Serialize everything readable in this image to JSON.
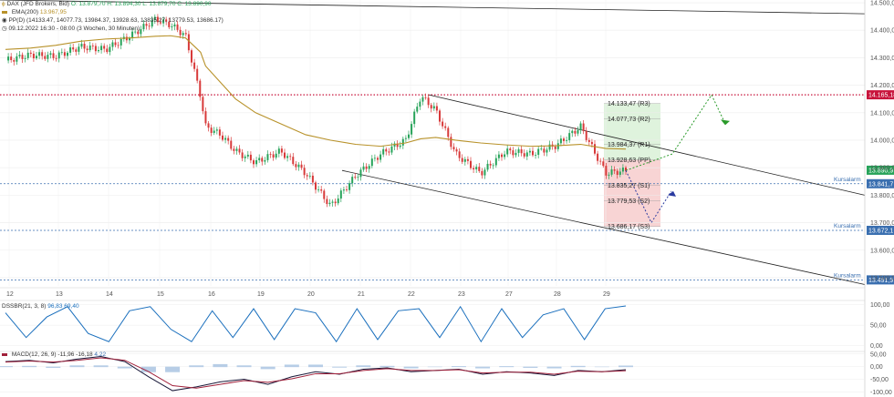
{
  "legend": {
    "instrument": "DAX (JFD Brokers, Bid)",
    "ohlc": "O: 13.879,70  H: 13.894,30  L: 13.879,70  C: 13.890,90",
    "ema_label": "EMA(200)",
    "ema_value": "13.967,95",
    "pp_label": "PP(D)",
    "pp_values": "(14133.47, 14077.73, 13984.37, 13928.63, 13835.27, 13779.53, 13686.17)",
    "timestamp": "09.12.2022 16:30 - 08:00",
    "range": "(3 Wochen, 30 Minuten)",
    "dss_label": "DSSBR(21, 3, 8)",
    "dss_values": "96,83  69,40",
    "macd_label": "MACD(12, 26, 9)",
    "macd_values": "-11,96  -16,18",
    "macd_extra": "4,22"
  },
  "colors": {
    "up": "#27a35a",
    "down": "#d83a3a",
    "ema": "#b8922a",
    "resistance": "#c8143c",
    "alarm": "#3a6fb0",
    "channel": "#222222",
    "arrow_green": "#2a9a2a",
    "arrow_blue": "#2a3aa0",
    "zone_green": "#dff3dd",
    "zone_red": "#f8d4d4",
    "dss": "#1a6fbd",
    "macd": "#1a1a3a",
    "signal": "#a0203a"
  },
  "chart_data": {
    "type": "line",
    "title": "DAX (JFD Brokers, Bid)",
    "xlabel": "",
    "ylabel": "",
    "x_ticks": [
      "12",
      "13",
      "14",
      "15",
      "16",
      "19",
      "20",
      "21",
      "22",
      "23",
      "27",
      "28",
      "29"
    ],
    "y_ticks": [
      "14.500,00",
      "14.400,00",
      "14.300,00",
      "14.200,00",
      "14.100,00",
      "14.000,00",
      "13.900,00",
      "13.800,00",
      "13.700,00",
      "13.600,00",
      "13.500,00"
    ],
    "ylim": [
      13470,
      14510
    ],
    "x": [
      0,
      0.5,
      1,
      1.5,
      2,
      2.5,
      3,
      3.3,
      3.6,
      3.9,
      4,
      4.3,
      4.6,
      5,
      5.5,
      6,
      6.5,
      7,
      7.5,
      8,
      8.3,
      8.6,
      9,
      9.5,
      10,
      10.5,
      11,
      11.5,
      12,
      12.4
    ],
    "series": [
      {
        "name": "DAX",
        "values": [
          14290,
          14310,
          14305,
          14340,
          14330,
          14380,
          14440,
          14420,
          14380,
          14160,
          14050,
          14020,
          13960,
          13920,
          13960,
          13880,
          13760,
          13870,
          13950,
          14000,
          14160,
          14110,
          13950,
          13880,
          13960,
          13950,
          13980,
          14050,
          13880,
          13890
        ]
      },
      {
        "name": "EMA(200)",
        "values": [
          14330,
          14335,
          14345,
          14360,
          14368,
          14372,
          14378,
          14380,
          14372,
          14320,
          14270,
          14210,
          14150,
          14100,
          14060,
          14020,
          14000,
          13985,
          13978,
          13990,
          14005,
          14010,
          14000,
          13990,
          13983,
          13978,
          13980,
          13985,
          13970,
          13968
        ]
      }
    ],
    "levels": [
      {
        "label": "14.133,47 (R3)",
        "value": 14133.47
      },
      {
        "label": "14.077,73 (R2)",
        "value": 14077.73
      },
      {
        "label": "13.984,37 (R1)",
        "value": 13984.37
      },
      {
        "label": "13.928,63 (PP)",
        "value": 13928.63
      },
      {
        "label": "13.835,27 (S1)",
        "value": 13835.27
      },
      {
        "label": "13.779,53 (S2)",
        "value": 13779.53
      },
      {
        "label": "13.686,17 (S3)",
        "value": 13686.17
      }
    ],
    "resistance": {
      "value": 14165.18,
      "badge": "14.165,18"
    },
    "alarms": [
      {
        "label": "Kursalarm",
        "value": 13841.7,
        "badge": "13.841,7"
      },
      {
        "label": "Kursalarm",
        "value": 13672.1,
        "badge": "13.672,1"
      },
      {
        "label": "Kursalarm",
        "value": 13491.9,
        "badge": "13.491,9"
      }
    ],
    "last_price": {
      "value": 13890.9,
      "badge": "13.890,9"
    },
    "dss": {
      "ticks": [
        "100,00",
        "50,00",
        "0,00"
      ],
      "ylim": [
        -5,
        110
      ],
      "values": [
        80,
        20,
        70,
        95,
        30,
        10,
        85,
        95,
        40,
        10,
        85,
        20,
        90,
        15,
        90,
        80,
        10,
        90,
        15,
        85,
        90,
        20,
        95,
        10,
        90,
        20,
        75,
        90,
        15,
        90,
        96.83
      ]
    },
    "macd": {
      "ticks": [
        "50,00",
        "0,00",
        "-50,00",
        "-100,00"
      ],
      "ylim": [
        -120,
        60
      ],
      "macd": [
        20,
        25,
        15,
        30,
        40,
        20,
        -40,
        -95,
        -80,
        -60,
        -50,
        -70,
        -40,
        -20,
        -30,
        -10,
        -5,
        -20,
        -15,
        -10,
        -30,
        -20,
        -25,
        -35,
        -15,
        -20,
        -11.96
      ],
      "signal": [
        18,
        22,
        18,
        25,
        35,
        25,
        -20,
        -75,
        -85,
        -70,
        -55,
        -62,
        -48,
        -28,
        -28,
        -15,
        -8,
        -15,
        -15,
        -12,
        -25,
        -22,
        -22,
        -30,
        -18,
        -20,
        -16.18
      ]
    }
  }
}
